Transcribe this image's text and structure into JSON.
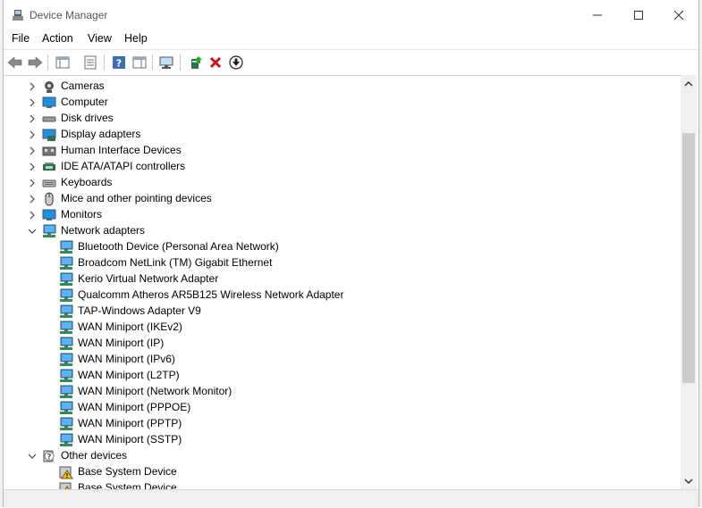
{
  "window": {
    "title": "Device Manager"
  },
  "menu": [
    "File",
    "Action",
    "View",
    "Help"
  ],
  "toolbar": [
    {
      "name": "back-icon"
    },
    {
      "name": "forward-icon"
    },
    {
      "name": "show-hide-console-tree-icon"
    },
    {
      "name": "properties-icon"
    },
    {
      "name": "help-icon"
    },
    {
      "name": "show-action-pane-icon"
    },
    {
      "name": "scan-hardware-changes-icon"
    },
    {
      "name": "update-driver-icon"
    },
    {
      "name": "uninstall-device-icon"
    },
    {
      "name": "disable-device-icon"
    }
  ],
  "tree": [
    {
      "label": "Cameras",
      "level": 0,
      "state": "collapsed",
      "icon": "camera-icon"
    },
    {
      "label": "Computer",
      "level": 0,
      "state": "collapsed",
      "icon": "computer-icon"
    },
    {
      "label": "Disk drives",
      "level": 0,
      "state": "collapsed",
      "icon": "disk-drive-icon"
    },
    {
      "label": "Display adapters",
      "level": 0,
      "state": "collapsed",
      "icon": "display-adapter-icon"
    },
    {
      "label": "Human Interface Devices",
      "level": 0,
      "state": "collapsed",
      "icon": "hid-icon"
    },
    {
      "label": "IDE ATA/ATAPI controllers",
      "level": 0,
      "state": "collapsed",
      "icon": "ide-controller-icon"
    },
    {
      "label": "Keyboards",
      "level": 0,
      "state": "collapsed",
      "icon": "keyboard-icon"
    },
    {
      "label": "Mice and other pointing devices",
      "level": 0,
      "state": "collapsed",
      "icon": "mouse-icon"
    },
    {
      "label": "Monitors",
      "level": 0,
      "state": "collapsed",
      "icon": "monitor-icon"
    },
    {
      "label": "Network adapters",
      "level": 0,
      "state": "expanded",
      "icon": "network-adapter-icon"
    },
    {
      "label": "Bluetooth Device (Personal Area Network)",
      "level": 1,
      "icon": "network-adapter-icon"
    },
    {
      "label": "Broadcom NetLink (TM) Gigabit Ethernet",
      "level": 1,
      "icon": "network-adapter-icon"
    },
    {
      "label": "Kerio Virtual Network Adapter",
      "level": 1,
      "icon": "network-adapter-icon"
    },
    {
      "label": "Qualcomm Atheros AR5B125 Wireless Network Adapter",
      "level": 1,
      "icon": "network-adapter-icon"
    },
    {
      "label": "TAP-Windows Adapter V9",
      "level": 1,
      "icon": "network-adapter-icon"
    },
    {
      "label": "WAN Miniport (IKEv2)",
      "level": 1,
      "icon": "network-adapter-icon"
    },
    {
      "label": "WAN Miniport (IP)",
      "level": 1,
      "icon": "network-adapter-icon"
    },
    {
      "label": "WAN Miniport (IPv6)",
      "level": 1,
      "icon": "network-adapter-icon"
    },
    {
      "label": "WAN Miniport (L2TP)",
      "level": 1,
      "icon": "network-adapter-icon"
    },
    {
      "label": "WAN Miniport (Network Monitor)",
      "level": 1,
      "icon": "network-adapter-icon"
    },
    {
      "label": "WAN Miniport (PPPOE)",
      "level": 1,
      "icon": "network-adapter-icon"
    },
    {
      "label": "WAN Miniport (PPTP)",
      "level": 1,
      "icon": "network-adapter-icon"
    },
    {
      "label": "WAN Miniport (SSTP)",
      "level": 1,
      "icon": "network-adapter-icon"
    },
    {
      "label": "Other devices",
      "level": 0,
      "state": "expanded",
      "icon": "other-devices-icon"
    },
    {
      "label": "Base System Device",
      "level": 1,
      "icon": "warning-device-icon"
    },
    {
      "label": "Base System Device",
      "level": 1,
      "icon": "warning-device-icon"
    }
  ],
  "colors": {
    "accent": "#1e90e0",
    "delete": "#d01010"
  }
}
